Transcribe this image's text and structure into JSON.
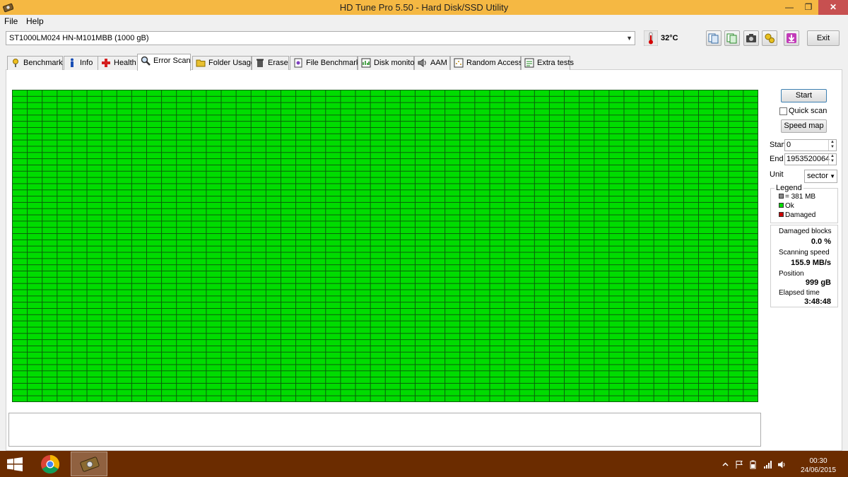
{
  "window": {
    "title": "HD Tune Pro 5.50 - Hard Disk/SSD Utility",
    "minimize": "—",
    "maximize": "❐",
    "close": "✕"
  },
  "menu": {
    "file": "File",
    "help": "Help"
  },
  "toolbar": {
    "drive": "ST1000LM024 HN-M101MBB (1000 gB)",
    "temperature": "32°C",
    "exit_label": "Exit",
    "icons": [
      "copy-info-icon",
      "copy-all-icon",
      "screenshot-icon",
      "options-icon",
      "save-icon"
    ]
  },
  "tabs": [
    {
      "label": "Benchmark",
      "icon": "benchmark-icon"
    },
    {
      "label": "Info",
      "icon": "info-icon"
    },
    {
      "label": "Health",
      "icon": "health-icon"
    },
    {
      "label": "Error Scan",
      "icon": "error-scan-icon",
      "active": true
    },
    {
      "label": "Folder Usage",
      "icon": "folder-icon"
    },
    {
      "label": "Erase",
      "icon": "erase-icon"
    },
    {
      "label": "File Benchmark",
      "icon": "file-benchmark-icon"
    },
    {
      "label": "Disk monitor",
      "icon": "disk-monitor-icon"
    },
    {
      "label": "AAM",
      "icon": "aam-icon"
    },
    {
      "label": "Random Access",
      "icon": "random-access-icon"
    },
    {
      "label": "Extra tests",
      "icon": "extra-tests-icon"
    }
  ],
  "scan": {
    "block_state": "Ok",
    "ok_color": "#00dc00",
    "damaged_color": "#cc0000"
  },
  "controls": {
    "start_button": "Start",
    "quick_scan_label": "Quick scan",
    "quick_scan_checked": false,
    "speed_map_button": "Speed map",
    "start_label": "Start",
    "start_value": "0",
    "end_label": "End",
    "end_value": "1953520064",
    "unit_label": "Unit",
    "unit_value": "sector"
  },
  "legend": {
    "title": "Legend",
    "block_size": "= 381 MB",
    "ok": "Ok",
    "damaged": "Damaged"
  },
  "stats": {
    "damaged_blocks_label": "Damaged blocks",
    "damaged_blocks_value": "0.0 %",
    "scanning_speed_label": "Scanning speed",
    "scanning_speed_value": "155.9 MB/s",
    "position_label": "Position",
    "position_value": "999 gB",
    "elapsed_time_label": "Elapsed time",
    "elapsed_time_value": "3:48:48"
  },
  "taskbar": {
    "time": "00:30",
    "date": "24/06/2015",
    "apps": [
      "chrome-icon",
      "hdtune-icon"
    ]
  }
}
